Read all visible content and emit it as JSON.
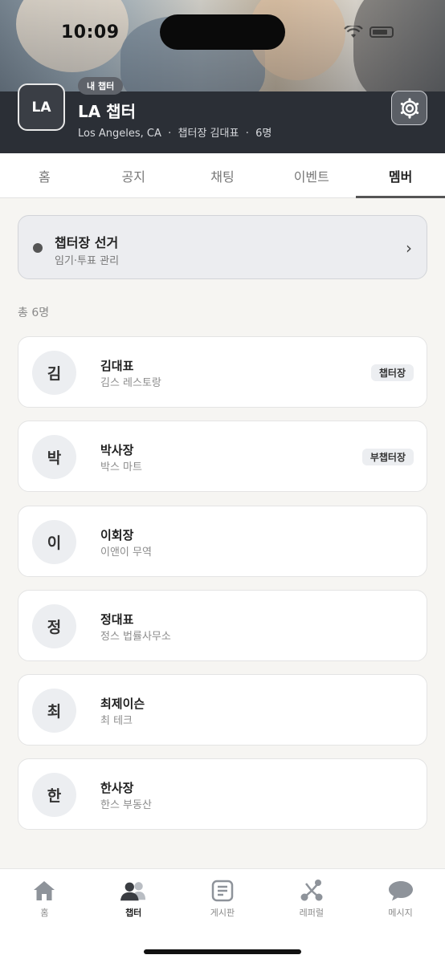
{
  "status_bar": {
    "time": "10:09"
  },
  "chapter": {
    "logo_text": "LA",
    "badge": "내 챕터",
    "name": "LA 챕터",
    "meta": "Los Angeles, CA  ·  챕터장 김대표  ·  6명"
  },
  "tabs": [
    {
      "label": "홈",
      "active": false
    },
    {
      "label": "공지",
      "active": false
    },
    {
      "label": "채팅",
      "active": false
    },
    {
      "label": "이벤트",
      "active": false
    },
    {
      "label": "멤버",
      "active": true
    }
  ],
  "election": {
    "title": "챕터장 선거",
    "subtitle": "임기·투표 관리",
    "chevron": "›"
  },
  "members": {
    "count_label": "총 6명",
    "items": [
      {
        "initial": "김",
        "name": "김대표",
        "company": "김스 레스토랑",
        "role": "챕터장"
      },
      {
        "initial": "박",
        "name": "박사장",
        "company": "박스 마트",
        "role": "부챕터장"
      },
      {
        "initial": "이",
        "name": "이회장",
        "company": "이앤이 무역",
        "role": ""
      },
      {
        "initial": "정",
        "name": "정대표",
        "company": "정스 법률사무소",
        "role": ""
      },
      {
        "initial": "최",
        "name": "최제이슨",
        "company": "최 테크",
        "role": ""
      },
      {
        "initial": "한",
        "name": "한사장",
        "company": "한스 부동산",
        "role": ""
      }
    ]
  },
  "bottom_nav": [
    {
      "label": "홈",
      "icon": "home-icon",
      "active": false
    },
    {
      "label": "챕터",
      "icon": "people-icon",
      "active": true
    },
    {
      "label": "게시판",
      "icon": "board-icon",
      "active": false
    },
    {
      "label": "레퍼럴",
      "icon": "referral-icon",
      "active": false
    },
    {
      "label": "메시지",
      "icon": "message-icon",
      "active": false
    }
  ],
  "colors": {
    "header_dark": "#2b2f36",
    "background": "#f6f5f2",
    "accent": "#555555"
  }
}
